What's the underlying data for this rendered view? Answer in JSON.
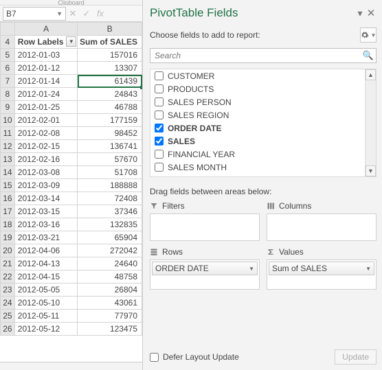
{
  "ribbon_group": "Clipboard",
  "namebox": "B7",
  "column_headers": {
    "A": "A",
    "B": "B"
  },
  "pivot_headers": {
    "row_labels": "Row Labels",
    "sum_sales": "Sum of SALES"
  },
  "selected_cell": {
    "row": 7,
    "col": "B"
  },
  "rows": [
    {
      "n": 4,
      "header": true
    },
    {
      "n": 5,
      "a": "2012-01-03",
      "b": "157016"
    },
    {
      "n": 6,
      "a": "2012-01-12",
      "b": "13307"
    },
    {
      "n": 7,
      "a": "2012-01-14",
      "b": "61439"
    },
    {
      "n": 8,
      "a": "2012-01-24",
      "b": "24843"
    },
    {
      "n": 9,
      "a": "2012-01-25",
      "b": "46788"
    },
    {
      "n": 10,
      "a": "2012-02-01",
      "b": "177159"
    },
    {
      "n": 11,
      "a": "2012-02-08",
      "b": "98452"
    },
    {
      "n": 12,
      "a": "2012-02-15",
      "b": "136741"
    },
    {
      "n": 13,
      "a": "2012-02-16",
      "b": "57670"
    },
    {
      "n": 14,
      "a": "2012-03-08",
      "b": "51708"
    },
    {
      "n": 15,
      "a": "2012-03-09",
      "b": "188888"
    },
    {
      "n": 16,
      "a": "2012-03-14",
      "b": "72408"
    },
    {
      "n": 17,
      "a": "2012-03-15",
      "b": "37346"
    },
    {
      "n": 18,
      "a": "2012-03-16",
      "b": "132835"
    },
    {
      "n": 19,
      "a": "2012-03-21",
      "b": "65904"
    },
    {
      "n": 20,
      "a": "2012-04-06",
      "b": "272042"
    },
    {
      "n": 21,
      "a": "2012-04-13",
      "b": "24640"
    },
    {
      "n": 22,
      "a": "2012-04-15",
      "b": "48758"
    },
    {
      "n": 23,
      "a": "2012-05-05",
      "b": "26804"
    },
    {
      "n": 24,
      "a": "2012-05-10",
      "b": "43061"
    },
    {
      "n": 25,
      "a": "2012-05-11",
      "b": "77970"
    },
    {
      "n": 26,
      "a": "2012-05-12",
      "b": "123475"
    }
  ],
  "pane": {
    "title": "PivotTable Fields",
    "choose_text": "Choose fields to add to report:",
    "search_placeholder": "Search",
    "fields": [
      {
        "label": "CUSTOMER",
        "checked": false
      },
      {
        "label": "PRODUCTS",
        "checked": false
      },
      {
        "label": "SALES PERSON",
        "checked": false
      },
      {
        "label": "SALES REGION",
        "checked": false
      },
      {
        "label": "ORDER DATE",
        "checked": true
      },
      {
        "label": "SALES",
        "checked": true
      },
      {
        "label": "FINANCIAL YEAR",
        "checked": false
      },
      {
        "label": "SALES MONTH",
        "checked": false
      }
    ],
    "drag_hint": "Drag fields between areas below:",
    "areas": {
      "filters": {
        "label": "Filters",
        "items": []
      },
      "columns": {
        "label": "Columns",
        "items": []
      },
      "rows": {
        "label": "Rows",
        "items": [
          "ORDER DATE"
        ]
      },
      "values": {
        "label": "Values",
        "items": [
          "Sum of SALES"
        ]
      }
    },
    "defer_label": "Defer Layout Update",
    "update_label": "Update"
  }
}
